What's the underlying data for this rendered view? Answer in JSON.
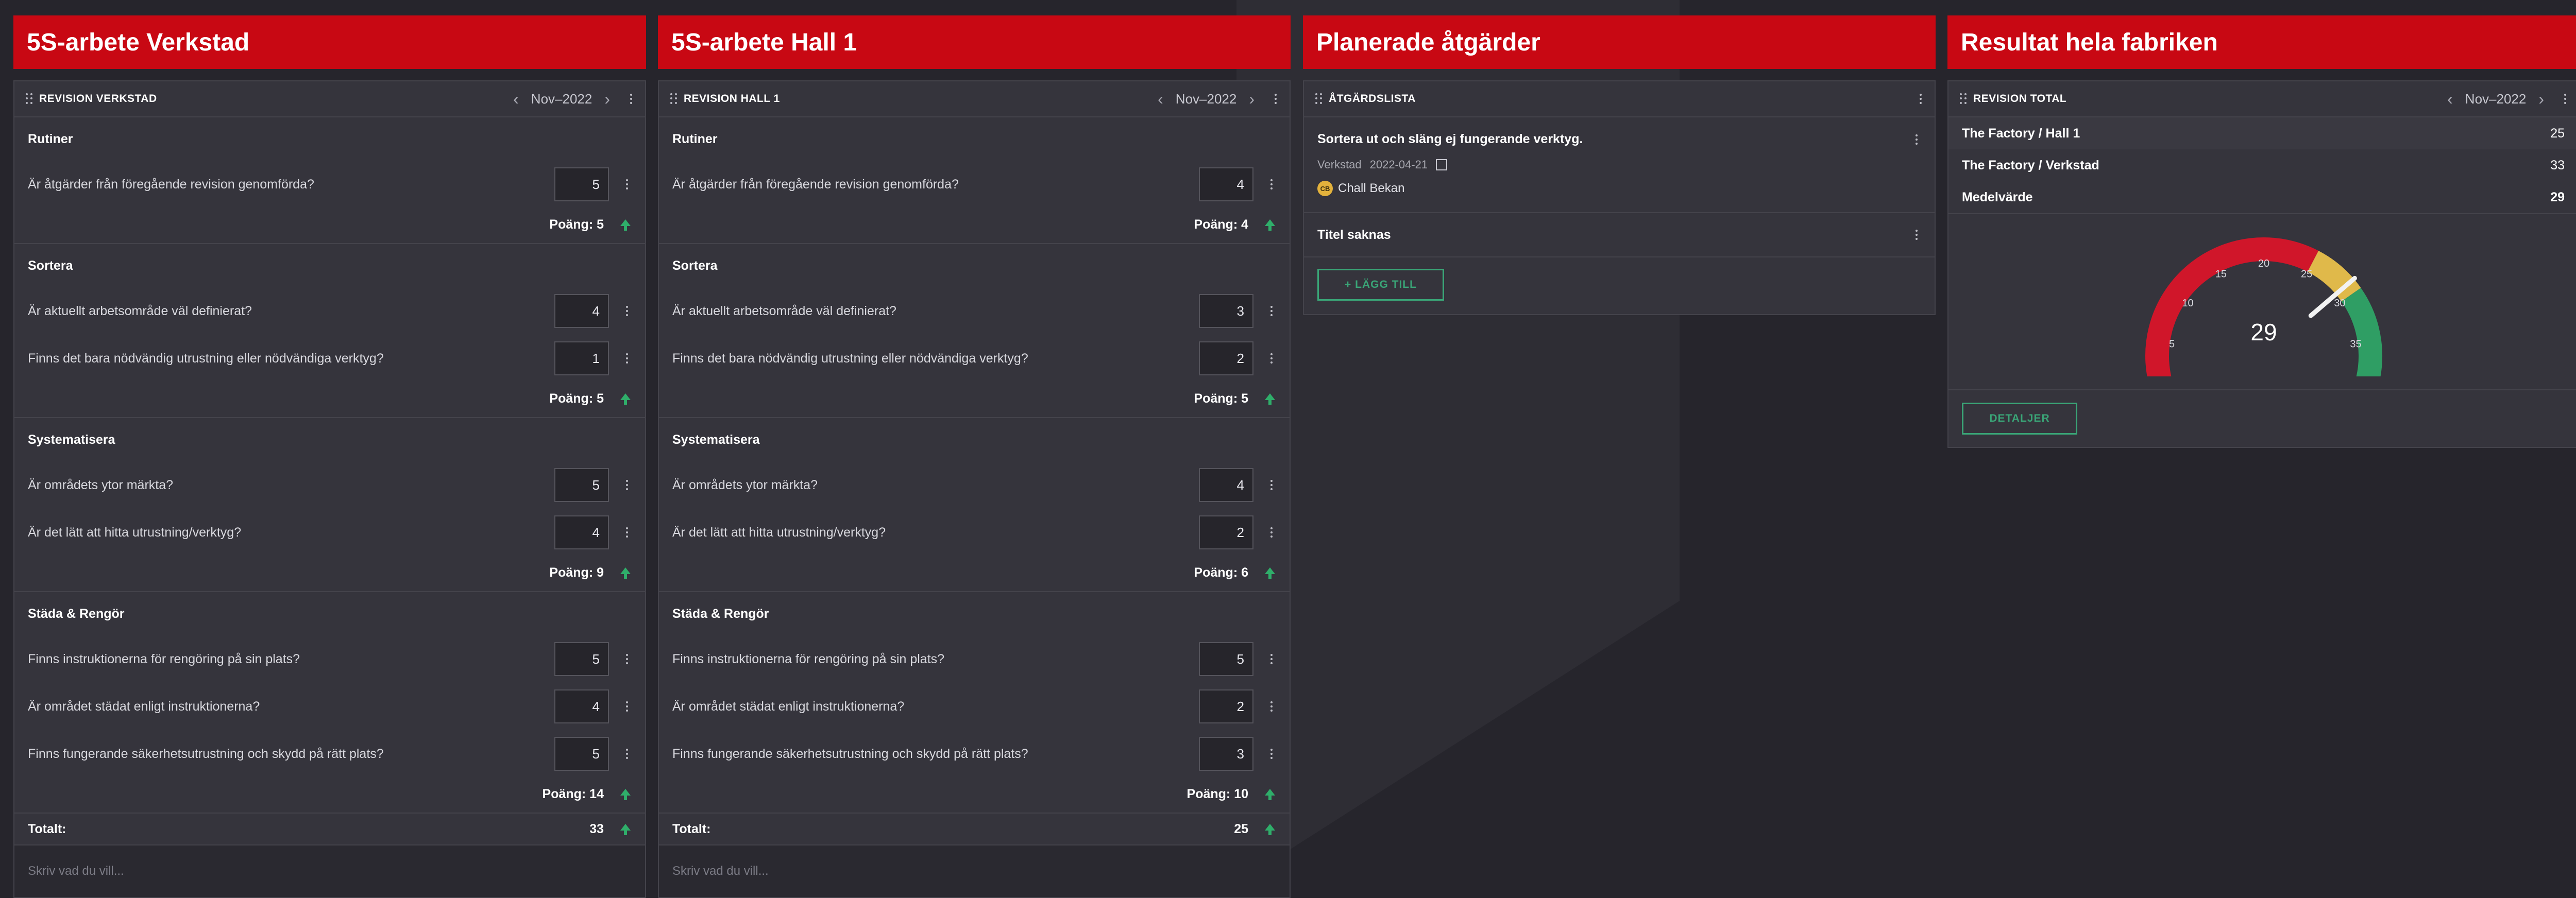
{
  "colors": {
    "banner": "#c80813",
    "accent_green": "#3aa577",
    "gauge_red": "#d0162a",
    "gauge_yellow": "#e0b94a",
    "gauge_green": "#2f9e64"
  },
  "columns": [
    {
      "banner": "5S-arbete Verkstad",
      "panel_title": "REVISION VERKSTAD",
      "month": "Nov–2022",
      "sections": [
        {
          "name": "Rutiner",
          "questions": [
            {
              "text": "Är åtgärder från föregående revision genomförda?",
              "value": "5"
            }
          ],
          "score": "Poäng: 5"
        },
        {
          "name": "Sortera",
          "questions": [
            {
              "text": "Är aktuellt arbetsområde väl definierat?",
              "value": "4"
            },
            {
              "text": "Finns det bara nödvändig utrustning eller nödvändiga verktyg?",
              "value": "1"
            }
          ],
          "score": "Poäng: 5"
        },
        {
          "name": "Systematisera",
          "questions": [
            {
              "text": "Är områdets ytor märkta?",
              "value": "5"
            },
            {
              "text": "Är det lätt att hitta utrustning/verktyg?",
              "value": "4"
            }
          ],
          "score": "Poäng: 9"
        },
        {
          "name": "Städa & Rengör",
          "questions": [
            {
              "text": "Finns instruktionerna för rengöring på sin plats?",
              "value": "5"
            },
            {
              "text": "Är området städat enligt instruktionerna?",
              "value": "4"
            },
            {
              "text": "Finns fungerande säkerhetsutrustning och skydd på rätt plats?",
              "value": "5"
            }
          ],
          "score": "Poäng: 14"
        }
      ],
      "total_label": "Totalt:",
      "total_value": "33",
      "notes_placeholder": "Skriv vad du vill..."
    },
    {
      "banner": "5S-arbete Hall 1",
      "panel_title": "REVISION HALL 1",
      "month": "Nov–2022",
      "sections": [
        {
          "name": "Rutiner",
          "questions": [
            {
              "text": "Är åtgärder från föregående revision genomförda?",
              "value": "4"
            }
          ],
          "score": "Poäng: 4"
        },
        {
          "name": "Sortera",
          "questions": [
            {
              "text": "Är aktuellt arbetsområde väl definierat?",
              "value": "3"
            },
            {
              "text": "Finns det bara nödvändig utrustning eller nödvändiga verktyg?",
              "value": "2"
            }
          ],
          "score": "Poäng: 5"
        },
        {
          "name": "Systematisera",
          "questions": [
            {
              "text": "Är områdets ytor märkta?",
              "value": "4"
            },
            {
              "text": "Är det lätt att hitta utrustning/verktyg?",
              "value": "2"
            }
          ],
          "score": "Poäng: 6"
        },
        {
          "name": "Städa & Rengör",
          "questions": [
            {
              "text": "Finns instruktionerna för rengöring på sin plats?",
              "value": "5"
            },
            {
              "text": "Är området städat enligt instruktionerna?",
              "value": "2"
            },
            {
              "text": "Finns fungerande säkerhetsutrustning och skydd på rätt plats?",
              "value": "3"
            }
          ],
          "score": "Poäng: 10"
        }
      ],
      "total_label": "Totalt:",
      "total_value": "25",
      "notes_placeholder": "Skriv vad du vill..."
    }
  ],
  "actions": {
    "banner": "Planerade åtgärder",
    "panel_title": "ÅTGÄRDSLISTA",
    "items": [
      {
        "title": "Sortera ut och släng ej fungerande verktyg.",
        "location": "Verkstad",
        "date": "2022-04-21",
        "assignee_initials": "CB",
        "assignee": "Chall Bekan"
      },
      {
        "title": "Titel saknas"
      }
    ],
    "add_label": "+ LÄGG TILL"
  },
  "results": {
    "banner": "Resultat hela fabriken",
    "panel_title": "REVISION TOTAL",
    "month": "Nov–2022",
    "rows": [
      {
        "name": "The Factory / Hall 1",
        "value": "25"
      },
      {
        "name": "The Factory / Verkstad",
        "value": "33"
      }
    ],
    "average_label": "Medelvärde",
    "average_value": "29",
    "gauge": {
      "min": 0,
      "max": 40,
      "value": 29,
      "ticks": [
        "0",
        "5",
        "10",
        "15",
        "20",
        "25",
        "30",
        "35",
        "40"
      ],
      "display": "29",
      "bands": [
        {
          "from": 0,
          "to": 25,
          "color": "#d0162a"
        },
        {
          "from": 25,
          "to": 30,
          "color": "#e0b94a"
        },
        {
          "from": 30,
          "to": 40,
          "color": "#2f9e64"
        }
      ]
    },
    "details_label": "DETALJER"
  },
  "icons": {
    "drag": "drag-handle-icon",
    "more": "kebab-menu-icon",
    "prev": "chevron-left-icon",
    "next": "chevron-right-icon",
    "score_up": "arrow-up-icon",
    "checkbox": "checkbox-icon"
  }
}
